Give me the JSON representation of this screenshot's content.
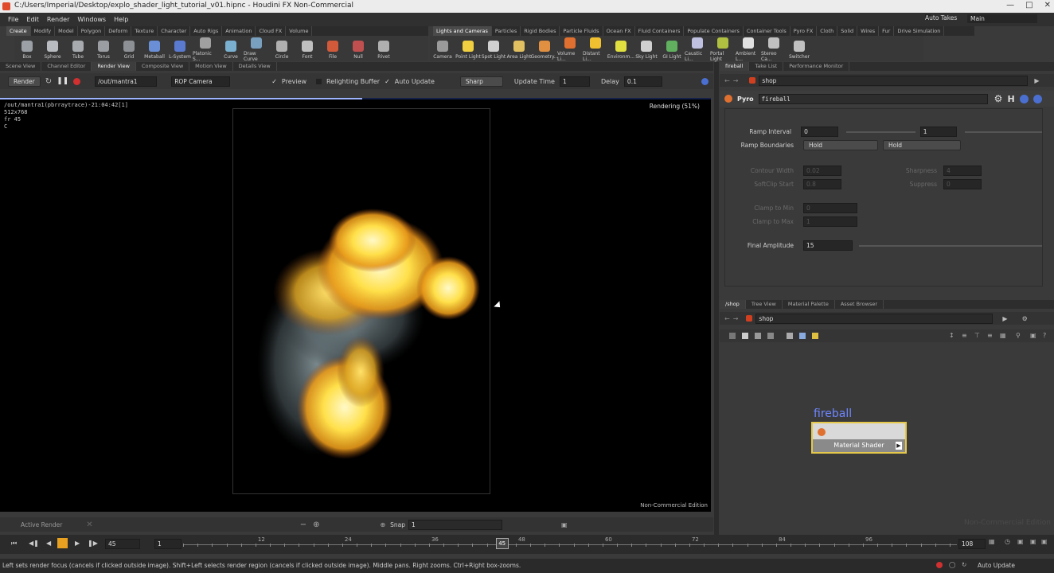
{
  "window": {
    "title": "C:/Users/Imperial/Desktop/explo_shader_light_tutorial_v01.hipnc - Houdini FX Non-Commercial"
  },
  "menu": [
    "File",
    "Edit",
    "Render",
    "Windows",
    "Help"
  ],
  "auto_takes": "Auto Takes",
  "desktop": "Main",
  "shelf_tabs_left": [
    "Create",
    "Modify",
    "Model",
    "Polygon",
    "Deform",
    "Texture",
    "Character",
    "Auto Rigs",
    "Animation",
    "Cloud FX",
    "Volume"
  ],
  "shelf_tabs_right": [
    "Lights and Cameras",
    "Particles",
    "Rigid Bodies",
    "Particle Fluids",
    "Ocean FX",
    "Fluid Containers",
    "Populate Containers",
    "Container Tools",
    "Pyro FX",
    "Cloth",
    "Solid",
    "Wires",
    "Fur",
    "Drive Simulation"
  ],
  "tools_left": [
    {
      "label": "Box",
      "color": "#9aa0a6"
    },
    {
      "label": "Sphere",
      "color": "#b8bcc0"
    },
    {
      "label": "Tube",
      "color": "#a7abaf"
    },
    {
      "label": "Torus",
      "color": "#9a9ea2"
    },
    {
      "label": "Grid",
      "color": "#8d9196"
    },
    {
      "label": "Metaball",
      "color": "#6a8fd6"
    },
    {
      "label": "L-System",
      "color": "#5a7ad0"
    },
    {
      "label": "Platonic S...",
      "color": "#a0a0a0"
    },
    {
      "label": "Curve",
      "color": "#7ab0d0"
    },
    {
      "label": "Draw Curve",
      "color": "#7aa0c0"
    },
    {
      "label": "Circle",
      "color": "#b0b0b0"
    },
    {
      "label": "Font",
      "color": "#c0c0c0"
    },
    {
      "label": "File",
      "color": "#d05a3a"
    },
    {
      "label": "Null",
      "color": "#c05050"
    },
    {
      "label": "Rivet",
      "color": "#b0b0b0"
    }
  ],
  "tools_right": [
    {
      "label": "Camera",
      "color": "#9a9a9a"
    },
    {
      "label": "Point Light",
      "color": "#f0d040"
    },
    {
      "label": "Spot Light",
      "color": "#d0d0d0"
    },
    {
      "label": "Area Light",
      "color": "#e0c060"
    },
    {
      "label": "Geometry...",
      "color": "#e09040"
    },
    {
      "label": "Volume Li...",
      "color": "#e07030"
    },
    {
      "label": "Distant Li...",
      "color": "#f0c030"
    },
    {
      "label": "Environm...",
      "color": "#e0e040"
    },
    {
      "label": "Sky Light",
      "color": "#d0d0d0"
    },
    {
      "label": "GI Light",
      "color": "#60b060"
    },
    {
      "label": "Caustic Li...",
      "color": "#c0c0e0"
    },
    {
      "label": "Portal Light",
      "color": "#b0c040"
    },
    {
      "label": "Ambient L...",
      "color": "#e0e0e0"
    },
    {
      "label": "Stereo Ca...",
      "color": "#c0c0c0"
    },
    {
      "label": "Switcher",
      "color": "#c0c0c0"
    }
  ],
  "left_pane_tabs": [
    "Scene View",
    "Channel Editor",
    "Render View",
    "Composite View",
    "Motion View",
    "Details View"
  ],
  "render_toolbar": {
    "render_btn": "Render",
    "rop_path": "/out/mantra1",
    "camera": "ROP Camera",
    "preview": "Preview",
    "relighting": "Relighting Buffer",
    "auto_update": "Auto Update",
    "sharp": "Sharp",
    "update_time_label": "Update Time",
    "update_time_value": "1",
    "delay_label": "Delay",
    "delay_value": "0.1"
  },
  "viewport": {
    "info_line1": "/out/mantra1(pbrraytrace)-21:04:42[1]",
    "info_line2": "512x768",
    "info_line3": "fr 45",
    "info_line4": "C",
    "status": "Rendering (51%)",
    "progress": 0.51,
    "watermark": "Non-Commercial Edition"
  },
  "active_render": "Active Render",
  "snap_label": "Snap",
  "snap_value": "1",
  "params_pane": {
    "tabs": [
      "fireball",
      "Take List",
      "Performance Monitor"
    ],
    "path": "shop",
    "node_type": "Pyro",
    "node_name": "fireball",
    "ramp_interval_label": "Ramp Interval",
    "ramp_interval_v1": "0",
    "ramp_interval_v2": "1",
    "ramp_boundaries_label": "Ramp Boundaries",
    "ramp_boundaries_v1": "Hold",
    "ramp_boundaries_v2": "Hold",
    "contour_width_label": "Contour Width",
    "contour_width_value": "0.02",
    "sharpness_label": "Sharpness",
    "sharpness_value": "4",
    "softclip_label": "SoftClip Start",
    "softclip_value": "0.8",
    "suppress_label": "Suppress",
    "suppress_value": "0",
    "clamp_min_label": "Clamp to Min",
    "clamp_min_value": "0",
    "clamp_max_label": "Clamp to Max",
    "clamp_max_value": "1",
    "final_amp_label": "Final Amplitude",
    "final_amp_value": "15"
  },
  "network_pane": {
    "tabs": [
      "/shop",
      "Tree View",
      "Material Palette",
      "Asset Browser"
    ],
    "path": "shop",
    "node_name": "fireball",
    "node_label": "Material Shader",
    "watermark": "Non-Commercial Edition"
  },
  "timeline": {
    "current_frame": "45",
    "start_frame": "1",
    "end_frame": "108",
    "ticks": [
      "12",
      "24",
      "36",
      "48",
      "60",
      "72",
      "84",
      "96"
    ],
    "playhead_label": "45"
  },
  "status_bar": {
    "message": "Left sets render focus (cancels if clicked outside image). Shift+Left selects render region (cancels if clicked outside image). Middle pans. Right zooms. Ctrl+Right box-zooms.",
    "auto_update": "Auto Update"
  },
  "colors": {
    "accent": "#6e86ff",
    "render_bg": "#000000",
    "panel": "#3a3a3a"
  }
}
